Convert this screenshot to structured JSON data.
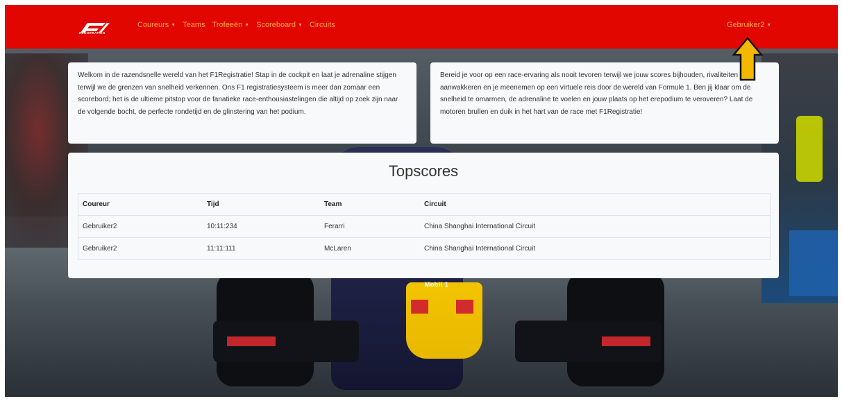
{
  "navbar": {
    "logo_text": "F1",
    "logo_subtitle": "REGISTRATION",
    "items": [
      {
        "label": "Coureurs",
        "dropdown": true
      },
      {
        "label": "Teams",
        "dropdown": false
      },
      {
        "label": "Trofeeën",
        "dropdown": true
      },
      {
        "label": "Scoreboard",
        "dropdown": true
      },
      {
        "label": "Circuits",
        "dropdown": false
      }
    ],
    "user": {
      "label": "Gebruiker2",
      "dropdown": true
    },
    "colors": {
      "background": "#e10600",
      "link": "#ffaa44"
    }
  },
  "intro": {
    "left": "Welkom in de razendsnelle wereld van het F1Registratie! Stap in de cockpit en laat je adrenaline stijgen terwijl we de grenzen van snelheid verkennen. Ons F1 registratiesysteem is meer dan zomaar een scorebord; het is de ultieme pitstop voor de fanatieke race-enthousiastelingen die altijd op zoek zijn naar de volgende bocht, de perfecte rondetijd en de glinstering van het podium.",
    "right": "Bereid je voor op een race-ervaring als nooit tevoren terwijl we jouw scores bijhouden, rivaliteiten aanwakkeren en je meenemen op een virtuele reis door de wereld van Formule 1. Ben jij klaar om de snelheid te omarmen, de adrenaline te voelen en jouw plaats op het erepodium te veroveren? Laat de motoren brullen en duik in het hart van de race met F1Registratie!"
  },
  "topscores": {
    "title": "Topscores",
    "columns": [
      "Coureur",
      "Tijd",
      "Team",
      "Circuit"
    ],
    "rows": [
      [
        "Gebruiker2",
        "10:11:234",
        "Ferarri",
        "China Shanghai International Circuit"
      ],
      [
        "Gebruiker2",
        "11:11:111",
        "McLaren",
        "China Shanghai International Circuit"
      ]
    ]
  },
  "background": {
    "sponsor_text": "Mobil 1"
  },
  "annotation": {
    "arrow_icon": "up-arrow-icon",
    "arrow_color": "#f5b800"
  }
}
